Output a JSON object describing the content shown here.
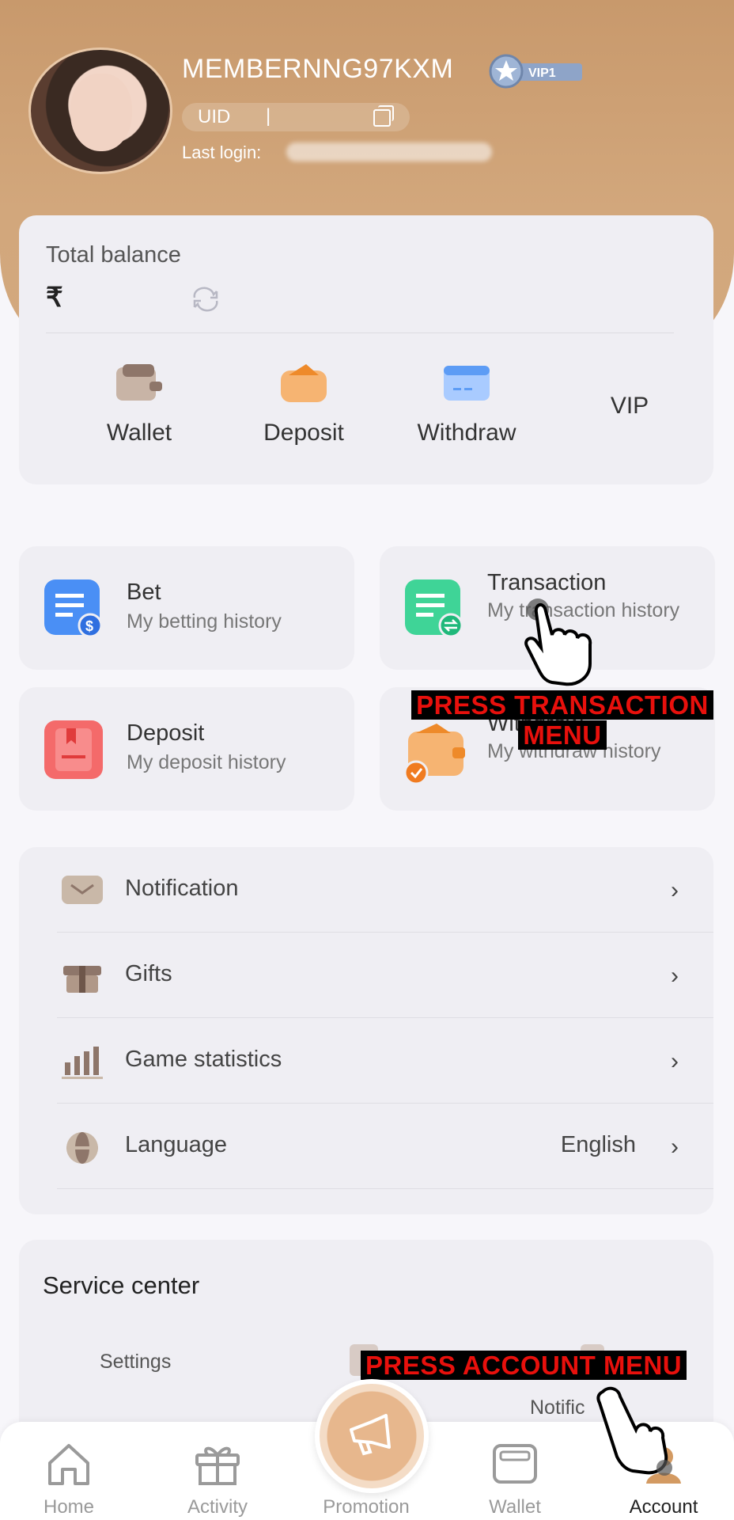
{
  "profile": {
    "username": "MEMBERNNG97KXM",
    "vip_badge": "VIP1",
    "uid_label": "UID",
    "uid_separator": "|",
    "last_login_label": "Last login:"
  },
  "balance": {
    "title": "Total balance",
    "currency_symbol": "₹"
  },
  "quick_actions": [
    {
      "label": "Wallet",
      "icon": "wallet-icon"
    },
    {
      "label": "Deposit",
      "icon": "deposit-icon"
    },
    {
      "label": "Withdraw",
      "icon": "withdraw-icon"
    },
    {
      "label": "VIP",
      "icon": ""
    }
  ],
  "history": {
    "bet": {
      "title": "Bet",
      "subtitle": "My betting history"
    },
    "transaction": {
      "title": "Transaction",
      "subtitle": "My transaction history"
    },
    "deposit": {
      "title": "Deposit",
      "subtitle": "My deposit history"
    },
    "withdraw": {
      "title": "Withdraw",
      "subtitle": "My withdraw history"
    }
  },
  "menu": {
    "notification": "Notification",
    "gifts": "Gifts",
    "game_statistics": "Game statistics",
    "language": "Language",
    "language_value": "English",
    "chevron": "›"
  },
  "service": {
    "title": "Service center",
    "settings": "Settings",
    "notification": "Notific"
  },
  "overlays": {
    "transaction_line1": "PRESS TRANSACTION",
    "transaction_line2": "MENU",
    "account": "PRESS ACCOUNT MENU"
  },
  "tabs": [
    {
      "label": "Home",
      "icon": "home-icon"
    },
    {
      "label": "Activity",
      "icon": "gift-icon"
    },
    {
      "label": "Promotion",
      "icon": "megaphone-icon"
    },
    {
      "label": "Wallet",
      "icon": "wallet-icon"
    },
    {
      "label": "Account",
      "icon": "account-icon"
    }
  ],
  "colors": {
    "header": "#c8996c",
    "accent_red": "#e8100c",
    "card": "#efeef3",
    "bet_icon": "#4a8ff5",
    "transaction_icon": "#3fd497",
    "deposit_icon": "#f46a6a",
    "withdraw_icon": "#f0a55c"
  }
}
